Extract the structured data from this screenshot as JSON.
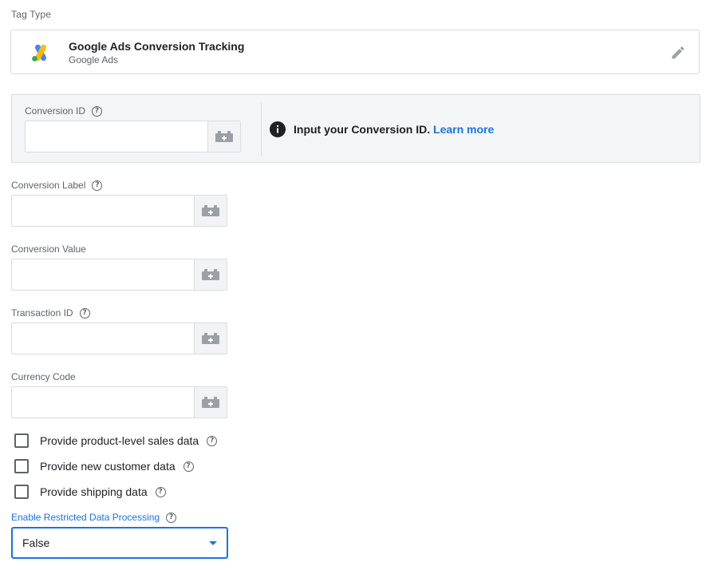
{
  "tag_type": {
    "section_label": "Tag Type",
    "title": "Google Ads Conversion Tracking",
    "subtitle": "Google Ads"
  },
  "conversion_id": {
    "label": "Conversion ID",
    "value": "",
    "info_text": "Input your Conversion ID.",
    "info_link": "Learn more"
  },
  "fields": {
    "conversion_label": {
      "label": "Conversion Label",
      "value": ""
    },
    "conversion_value": {
      "label": "Conversion Value",
      "value": ""
    },
    "transaction_id": {
      "label": "Transaction ID",
      "value": ""
    },
    "currency_code": {
      "label": "Currency Code",
      "value": ""
    }
  },
  "checkboxes": [
    {
      "label": "Provide product-level sales data",
      "checked": false
    },
    {
      "label": "Provide new customer data",
      "checked": false
    },
    {
      "label": "Provide shipping data",
      "checked": false
    }
  ],
  "restricted_data": {
    "label": "Enable Restricted Data Processing",
    "selected": "False"
  },
  "help_glyph": "?",
  "colors": {
    "accent": "#1a73e8",
    "border": "#dadce0",
    "panel_bg": "#f4f5f7",
    "text": "#202124",
    "muted": "#5f6368"
  }
}
